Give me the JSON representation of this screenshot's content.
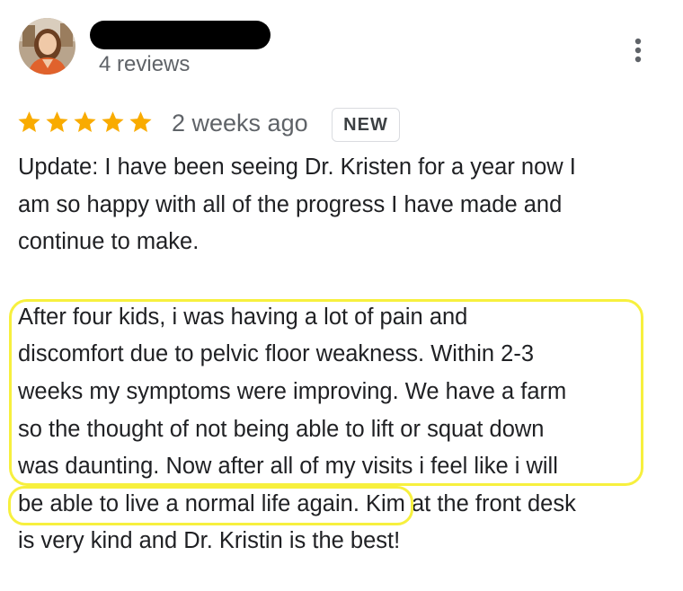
{
  "reviewer": {
    "avatar_icon": "profile-photo-avatar",
    "name_redacted": true,
    "reviews_count": "4 reviews"
  },
  "menu": {
    "icon": "more-vert-icon"
  },
  "rating": {
    "stars": 5,
    "max_stars": 5,
    "star_color": "#f9ab00",
    "date": "2 weeks ago",
    "badge": "NEW"
  },
  "review": {
    "paragraph1_lines": [
      "Update: I have been seeing Dr. Kristen for a year now I",
      "am so happy with all of the progress I have made and",
      "continue to make."
    ],
    "paragraph2_lines": [
      "After four kids, i was having a lot of pain and",
      "discomfort due to pelvic floor weakness. Within 2-3",
      "weeks my symptoms were improving. We have a farm",
      "so the thought of not being able to lift or squat down",
      "was daunting. Now after all of my visits i feel like i will",
      "be able to live a normal life again. Kim at the front desk",
      "is very kind and Dr. Kristin is the best!"
    ]
  },
  "highlight_color": "#f7f03e"
}
